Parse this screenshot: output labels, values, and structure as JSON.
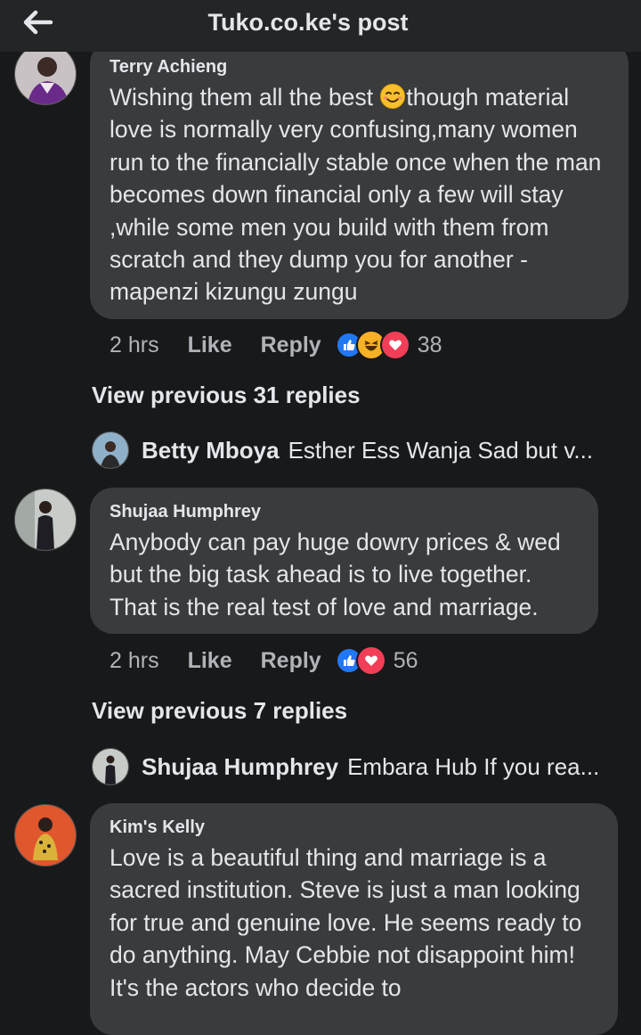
{
  "header": {
    "title": "Tuko.co.ke's post",
    "back_icon": "back-arrow-icon"
  },
  "comments": [
    {
      "author": "Terry Achieng",
      "text_before_emoji": "Wishing them all the best ",
      "emoji": "smiling-face-icon",
      "text_after_emoji": "though material love is normally very confusing,many women run to the financially stable once when the man becomes down financial only a  few will stay ,while some men you build with them from scratch and they dump you for another -mapenzi kizungu zungu",
      "time": "2 hrs",
      "like_label": "Like",
      "reply_label": "Reply",
      "reactions": [
        "like",
        "haha",
        "love"
      ],
      "reaction_count": "38",
      "view_previous": "View previous 31 replies",
      "latest_reply": {
        "name": "Betty Mboya",
        "text": "Esther Ess Wanja  Sad but v..."
      }
    },
    {
      "author": "Shujaa Humphrey",
      "text": "Anybody can pay huge dowry prices & wed but the big task ahead is to live together. That is the real test of love and marriage.",
      "time": "2 hrs",
      "like_label": "Like",
      "reply_label": "Reply",
      "reactions": [
        "like",
        "love"
      ],
      "reaction_count": "56",
      "view_previous": "View previous 7 replies",
      "latest_reply": {
        "name": "Shujaa Humphrey",
        "text": "Embara Hub If you rea..."
      }
    },
    {
      "author": "Kim's Kelly",
      "text": "Love is a beautiful thing and marriage is a sacred institution. Steve is just a man looking for true and genuine love. He seems ready to do anything. May Cebbie not disappoint him! It's the actors who decide to"
    }
  ],
  "colors": {
    "background": "#18191a",
    "bubble": "#3a3b3c",
    "secondary_text": "#b0b3b8",
    "like_blue": "#2078f4",
    "love_red": "#f33e58",
    "haha_yellow": "#f7b125"
  }
}
